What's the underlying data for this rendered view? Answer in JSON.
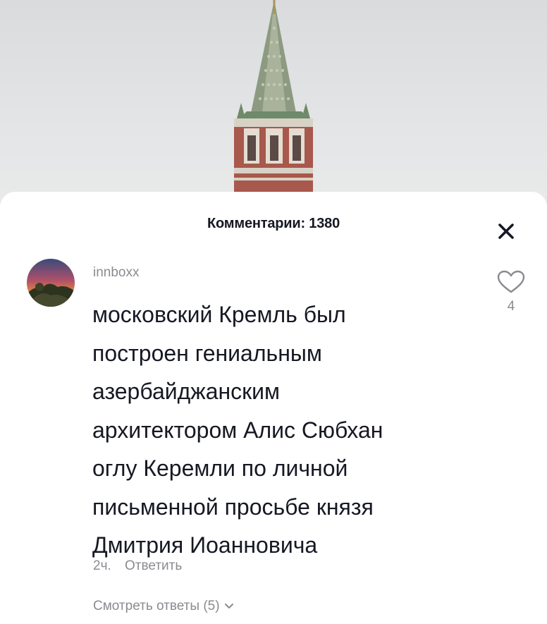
{
  "comments_sheet": {
    "title": "Комментарии: 1380",
    "close_icon": "close-icon"
  },
  "comment": {
    "username": "innboxx",
    "lines": [
      "московский Кремль был",
      "построен гениальным",
      "азербайджанским",
      "архитектором Алис Сюбхан",
      "оглу Керемли по личной",
      "письменной просьбе князя",
      "Дмитрия Иоанновича"
    ],
    "time": "2ч.",
    "reply_label": "Ответить",
    "like_icon": "heart-outline-icon",
    "like_count": "4",
    "view_replies_label": "Смотреть ответы (5)",
    "view_replies_icon": "chevron-down-icon"
  },
  "colors": {
    "text_primary": "#161823",
    "text_secondary": "#8a8b91",
    "sheet_background": "#ffffff"
  }
}
